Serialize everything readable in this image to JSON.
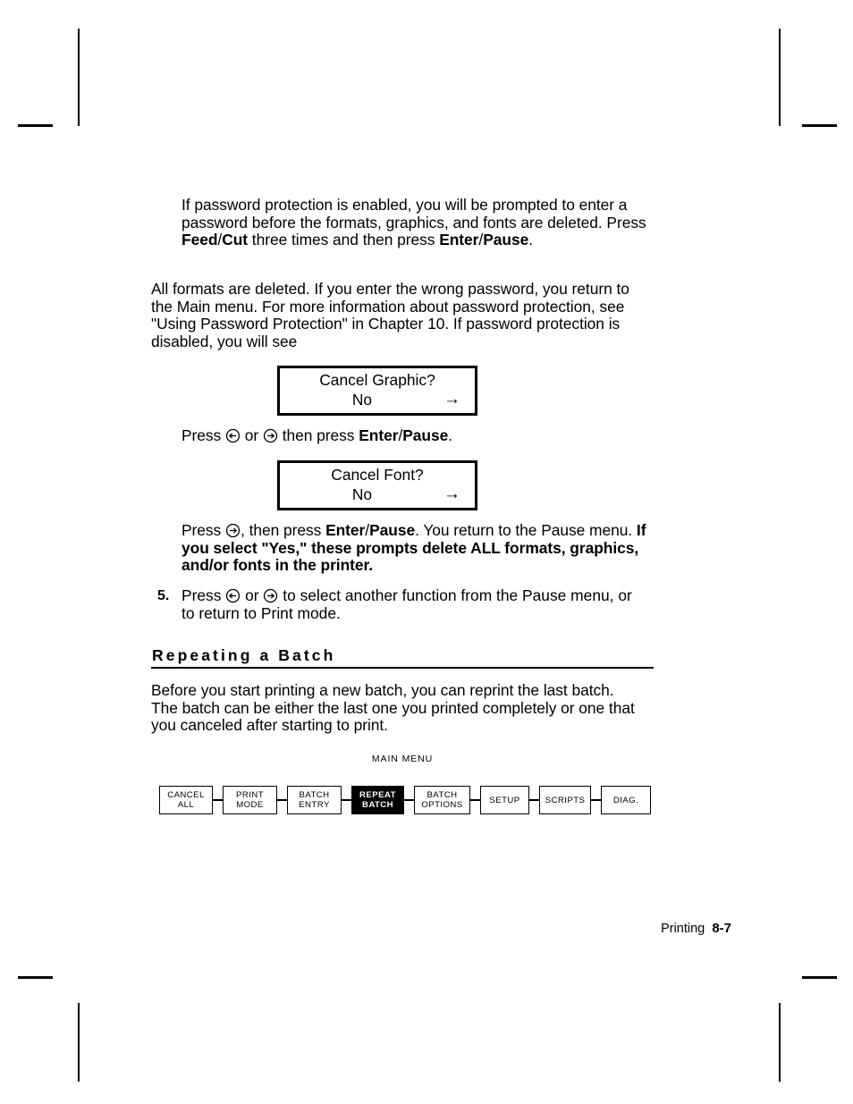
{
  "document": {
    "footer": {
      "section_label": "Printing",
      "page_number": "8-7"
    }
  },
  "body": {
    "paragraph_password_prompt": {
      "seg1": "If password protection is enabled, you will be prompted to enter a password before the formats, graphics, and fonts are deleted.  Press ",
      "bold1": "Feed",
      "slash1": "/",
      "bold2": "Cut",
      "seg2": " three times and then press ",
      "bold3": "Enter",
      "slash2": "/",
      "bold4": "Pause",
      "seg3": "."
    },
    "paragraph_all_formats": "All formats are deleted.  If you enter the wrong password, you return to the Main menu.  For more information about password protection, see \"Using Password Protection\" in Chapter 10.  If password protection is disabled, you will see",
    "paragraph_press_arrows": {
      "seg1": "Press ",
      "icon_left": "arrow-left-circle-icon",
      "glyph_left": "⊖",
      "seg2": " or ",
      "icon_right": "arrow-right-circle-icon",
      "glyph_right": "⊕",
      "seg3": " then press ",
      "bold1": "Enter",
      "slash1": "/",
      "bold2": "Pause",
      "seg4": "."
    },
    "paragraph_press_right": {
      "seg1": "Press ",
      "glyph_right": "⊕",
      "seg2": ", then press ",
      "bold1": "Enter",
      "slash1": "/",
      "bold2": "Pause",
      "seg3": ".  You return to the Pause menu.  ",
      "bold3": "If you select \"Yes,\" these prompts delete ALL formats, graphics, and/or fonts in the printer."
    },
    "list_item_5": {
      "number": "5.",
      "seg1": "Press ",
      "seg2": " or ",
      "seg3": " to select another function from the Pause menu, or to return to Print mode."
    }
  },
  "lcd_displays": [
    {
      "prompt": "Cancel Graphic?",
      "value": "No",
      "arrow": "→",
      "arrow_icon": "arrow-right-icon"
    },
    {
      "prompt": "Cancel Font?",
      "value": "No",
      "arrow": "→",
      "arrow_icon": "arrow-right-icon"
    }
  ],
  "section": {
    "heading": "Repeating a Batch",
    "paragraph": "Before you start printing a new batch, you can reprint the last batch.  The batch can be either the last one you printed completely or one that you canceled after starting to print."
  },
  "menu_diagram": {
    "caption": "MAIN MENU",
    "selected_index": 3,
    "items": [
      {
        "label": "CANCEL\nALL",
        "selected": false
      },
      {
        "label": "PRINT\nMODE",
        "selected": false
      },
      {
        "label": "BATCH\nENTRY",
        "selected": false
      },
      {
        "label": "REPEAT\nBATCH",
        "selected": true
      },
      {
        "label": "BATCH\nOPTIONS",
        "selected": false
      },
      {
        "label": "SETUP",
        "selected": false
      },
      {
        "label": "SCRIPTS",
        "selected": false
      },
      {
        "label": "DIAG.",
        "selected": false
      }
    ]
  },
  "colors": {
    "ink": "#000000",
    "paper": "#ffffff",
    "highlight_bg": "#000000",
    "highlight_fg": "#ffffff"
  }
}
